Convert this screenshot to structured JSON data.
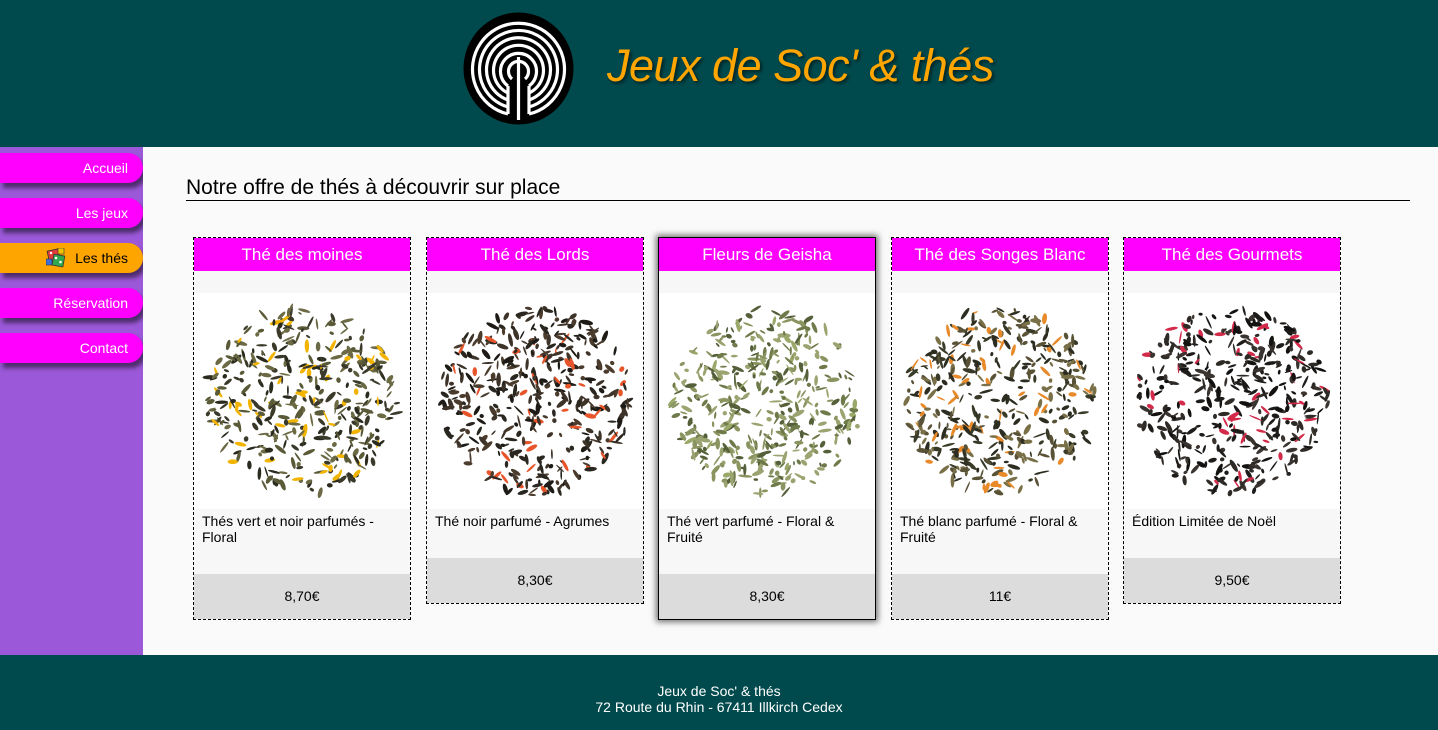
{
  "header": {
    "title": "Jeux de Soc' & thés"
  },
  "nav": {
    "items": [
      {
        "label": "Accueil"
      },
      {
        "label": "Les jeux"
      },
      {
        "label": "Les thés"
      },
      {
        "label": "Réservation"
      },
      {
        "label": "Contact"
      }
    ],
    "active": "Les thés"
  },
  "main": {
    "title": "Notre offre de thés à découvrir sur place",
    "teas": [
      {
        "name": "Thé des moines",
        "description": "Thés vert et noir parfumés - Floral",
        "price": "8,70€",
        "petal_color": "#f2b400"
      },
      {
        "name": "Thé des Lords",
        "description": "Thé noir parfumé - Agrumes",
        "price": "8,30€",
        "petal_color": "#e8552a"
      },
      {
        "name": "Fleurs de Geisha",
        "description": "Thé vert parfumé - Floral & Fruité",
        "price": "8,30€",
        "petal_color": "#9aa86a"
      },
      {
        "name": "Thé des Songes Blanc",
        "description": "Thé blanc parfumé - Floral & Fruité",
        "price": "11€",
        "petal_color": "#e88a2a"
      },
      {
        "name": "Thé des Gourmets",
        "description": "Édition Limitée de Noël",
        "price": "9,50€",
        "petal_color": "#d42a4a"
      }
    ]
  },
  "footer": {
    "line1": "Jeux de Soc' & thés",
    "line2": "72 Route du Rhin - 67411 Illkirch Cedex"
  },
  "colors": {
    "header_bg": "#004a4d",
    "title_orange": "#ffa500",
    "magenta": "#ff00ff",
    "sidebar_purple": "#9b58d8"
  },
  "icons": {
    "logo": "labyrinth-logo",
    "active_nav": "dice-icon"
  }
}
